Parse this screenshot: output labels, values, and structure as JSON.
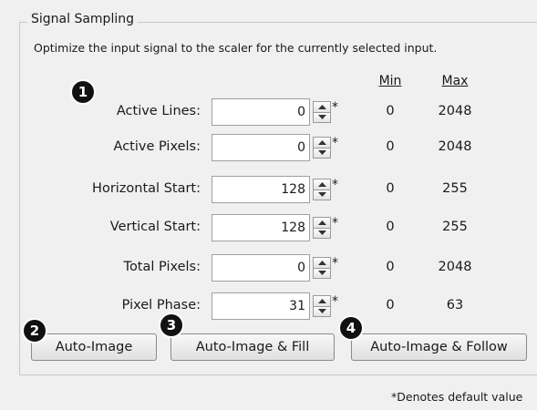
{
  "group": {
    "title": "Signal Sampling",
    "description": "Optimize the input signal to the scaler for the currently selected input."
  },
  "columns": {
    "min": "Min",
    "max": "Max"
  },
  "rows": [
    {
      "label": "Active Lines:",
      "value": "0",
      "min": "0",
      "max": "2048"
    },
    {
      "label": "Active Pixels:",
      "value": "0",
      "min": "0",
      "max": "2048"
    },
    {
      "label": "Horizontal Start:",
      "value": "128",
      "min": "0",
      "max": "255"
    },
    {
      "label": "Vertical Start:",
      "value": "128",
      "min": "0",
      "max": "255"
    },
    {
      "label": "Total Pixels:",
      "value": "0",
      "min": "0",
      "max": "2048"
    },
    {
      "label": "Pixel Phase:",
      "value": "31",
      "min": "0",
      "max": "63"
    }
  ],
  "default_marker": "*",
  "buttons": {
    "auto_image": "Auto-Image",
    "auto_image_fill": "Auto-Image & Fill",
    "auto_image_follow": "Auto-Image & Follow"
  },
  "badges": [
    "1",
    "2",
    "3",
    "4"
  ],
  "footer_note": "*Denotes default value"
}
